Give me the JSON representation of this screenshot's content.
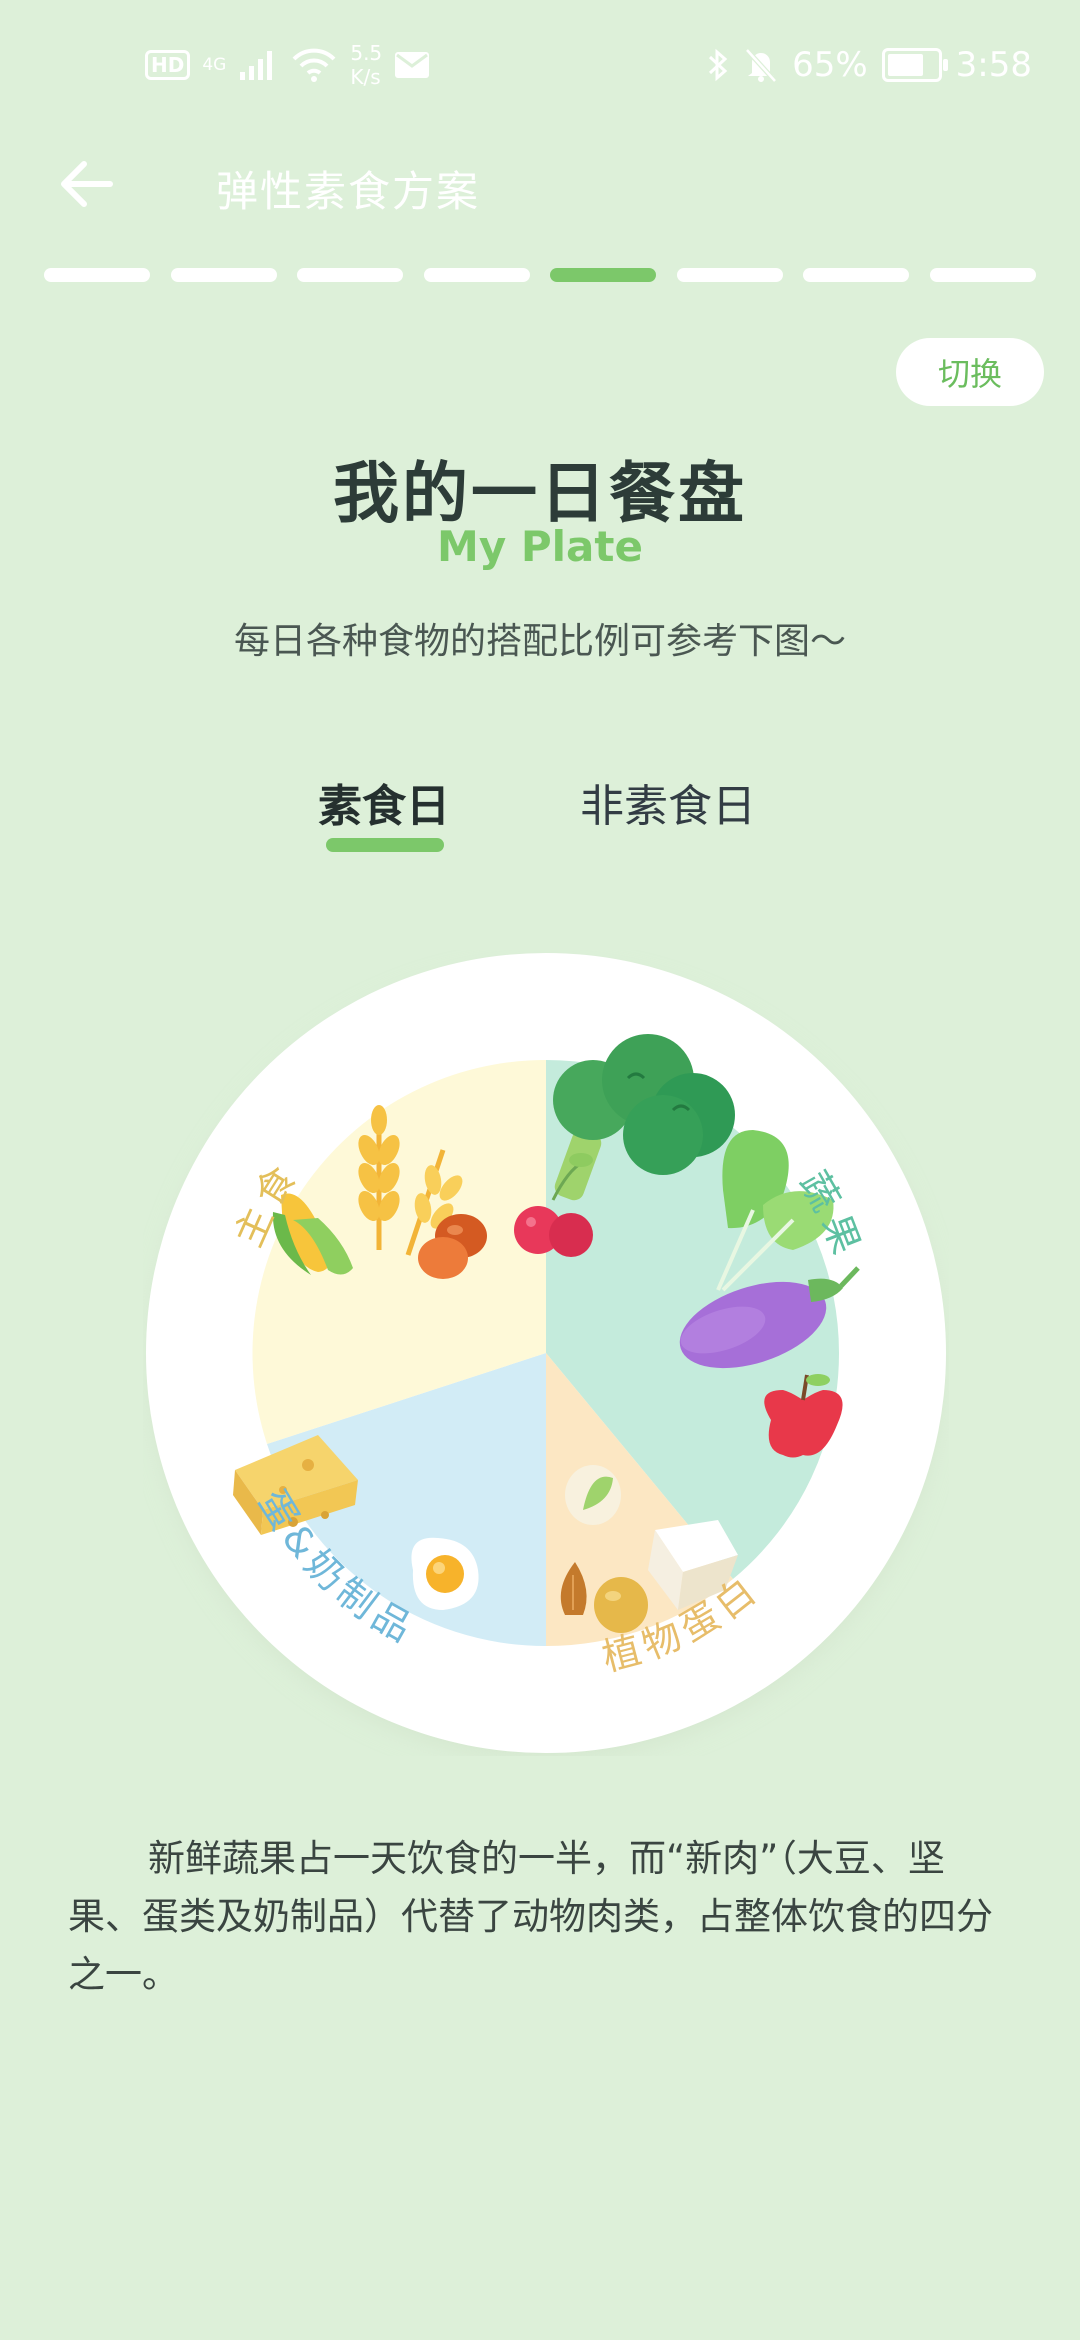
{
  "status_bar": {
    "hd": "HD",
    "network": "4G",
    "speed_value": "5.5",
    "speed_unit": "K/s",
    "battery": "65%",
    "time": "3:58"
  },
  "header": {
    "title": "弹性素食方案"
  },
  "progress": {
    "total_steps": 8,
    "current_step": 5
  },
  "switch_label": "切换",
  "title": "我的一日餐盘",
  "title_en": "My Plate",
  "subtitle": "每日各种食物的搭配比例可参考下图～",
  "tabs": [
    {
      "label": "素食日",
      "active": true
    },
    {
      "label": "非素食日",
      "active": false
    }
  ],
  "plate": {
    "sections": [
      {
        "label": "主食",
        "share": 0.2,
        "color": "#fef9d8",
        "label_color": "#e3bf5a"
      },
      {
        "label": "蔬果",
        "share": 0.5,
        "color": "#c4ebdc",
        "label_color": "#5dc0a1"
      },
      {
        "label": "植物蛋白",
        "share": 0.1,
        "color": "#fce7c3",
        "label_color": "#e7bd6a"
      },
      {
        "label": "蛋&奶制品",
        "share": 0.2,
        "color": "#d2ecf6",
        "label_color": "#6fb7d9"
      }
    ]
  },
  "description": "新鲜蔬果占一天饮食的一半，而“新肉”（大豆、坚果、蛋类及奶制品）代替了动物肉类，占整体饮食的四分之一。"
}
